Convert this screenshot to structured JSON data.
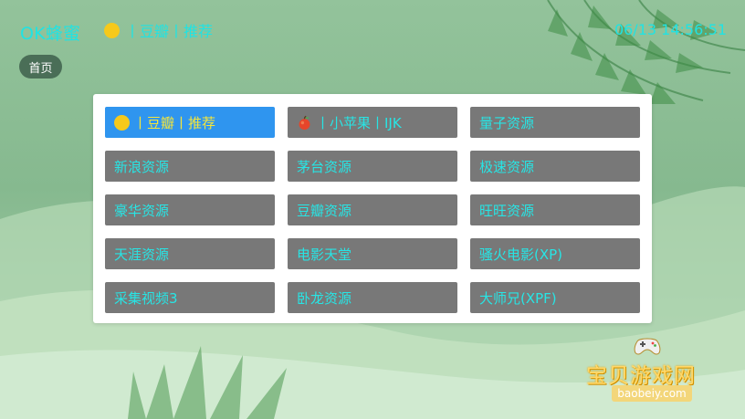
{
  "app": {
    "title": "OK蜂蜜",
    "current_source": "丨豆瓣丨推荐",
    "datetime": "06/13 14:56:51"
  },
  "nav": {
    "home_label": "首页"
  },
  "sources": [
    {
      "label": "丨豆瓣丨推荐",
      "icon": "yellow-circle-icon",
      "active": true
    },
    {
      "label": "丨小苹果丨IJK",
      "icon": "apple-icon",
      "active": false
    },
    {
      "label": "量子资源",
      "icon": "",
      "active": false
    },
    {
      "label": "新浪资源",
      "icon": "",
      "active": false
    },
    {
      "label": "茅台资源",
      "icon": "",
      "active": false
    },
    {
      "label": "极速资源",
      "icon": "",
      "active": false
    },
    {
      "label": "豪华资源",
      "icon": "",
      "active": false
    },
    {
      "label": "豆瓣资源",
      "icon": "",
      "active": false
    },
    {
      "label": "旺旺资源",
      "icon": "",
      "active": false
    },
    {
      "label": "天涯资源",
      "icon": "",
      "active": false
    },
    {
      "label": "电影天堂",
      "icon": "",
      "active": false
    },
    {
      "label": "骚火电影(XP)",
      "icon": "",
      "active": false
    },
    {
      "label": "采集视频3",
      "icon": "",
      "active": false
    },
    {
      "label": "卧龙资源",
      "icon": "",
      "active": false
    },
    {
      "label": "大师兄(XPF)",
      "icon": "",
      "active": false
    }
  ],
  "watermark": {
    "text": "宝贝游戏网",
    "url": "baobeiy.com"
  },
  "colors": {
    "accent_text": "#20e3e3",
    "active_item_bg": "#2f95ef",
    "active_item_text": "#f6e63a",
    "item_bg": "#787878"
  }
}
